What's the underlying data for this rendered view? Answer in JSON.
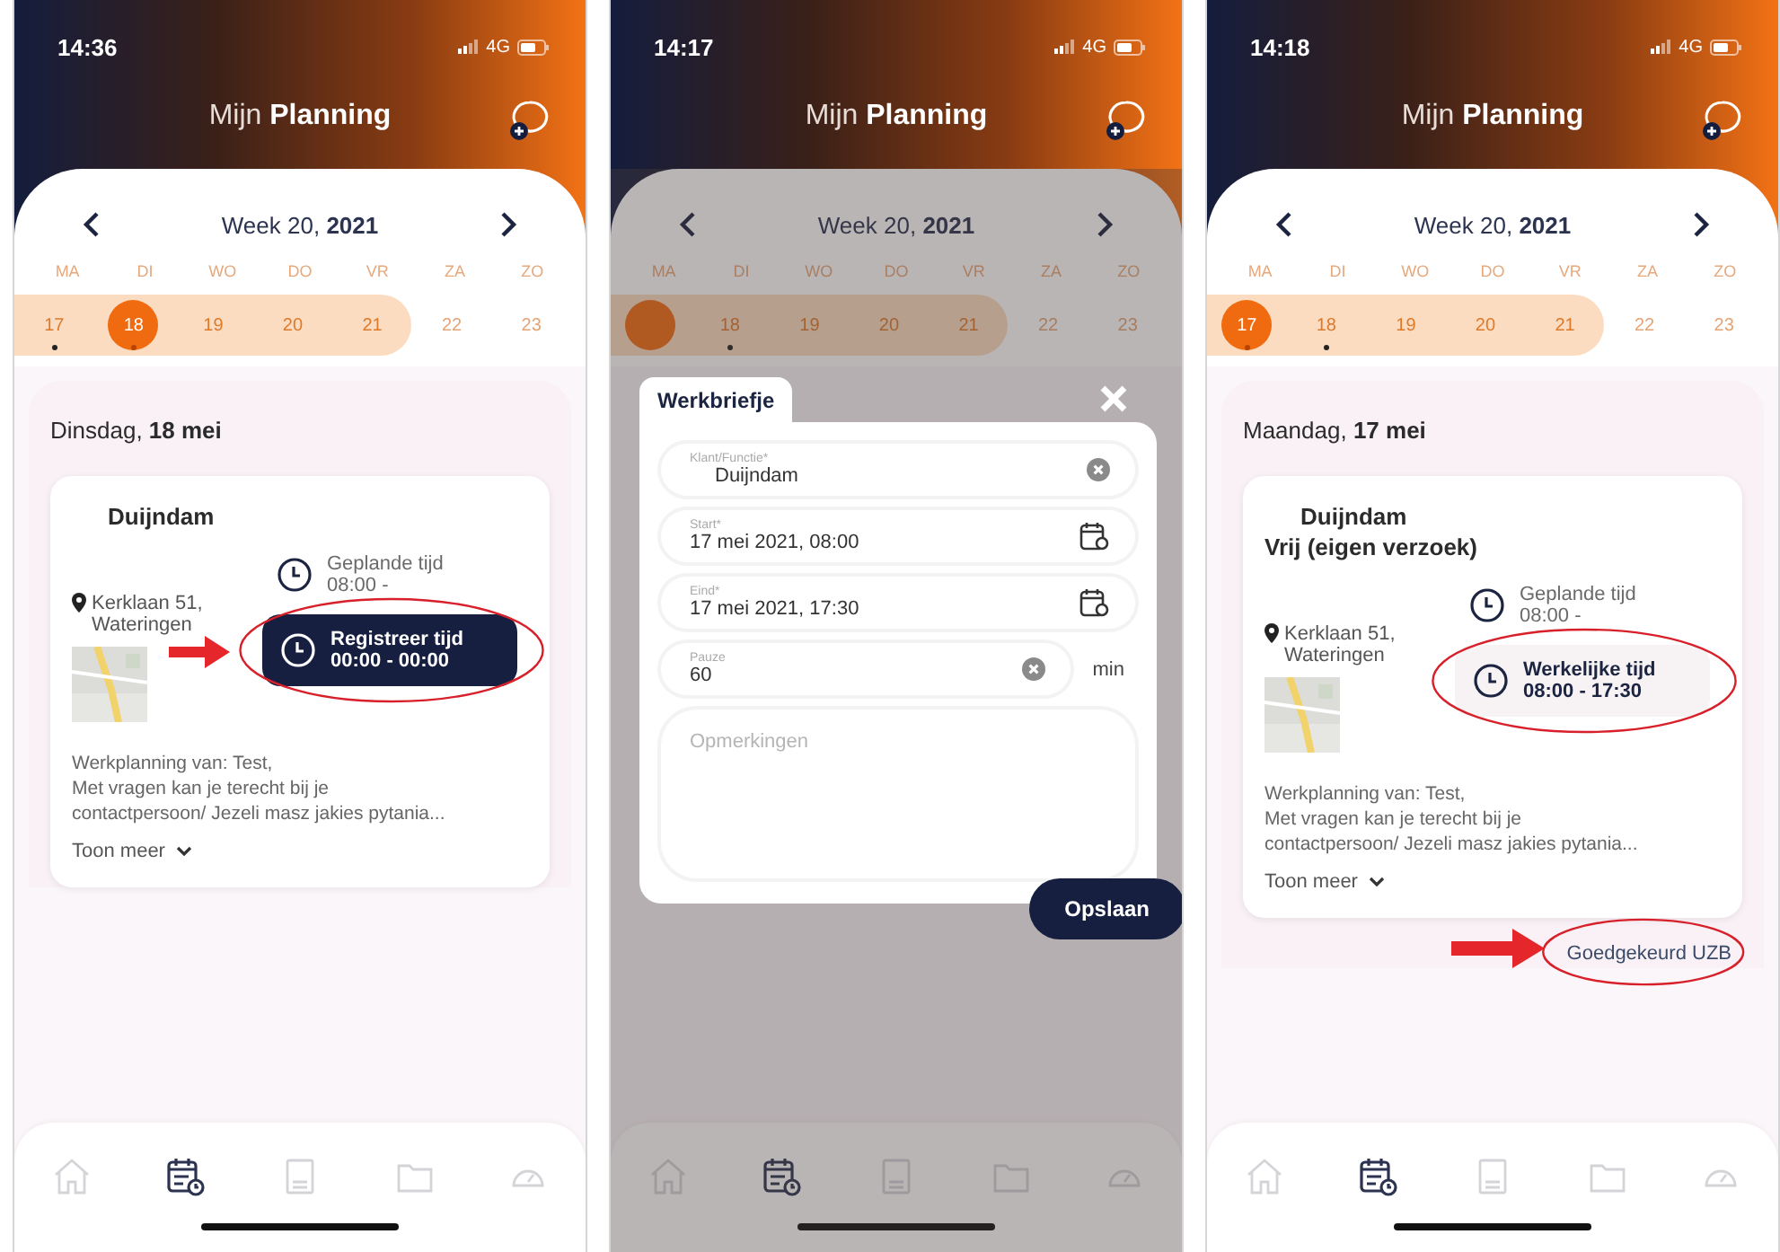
{
  "phones": [
    {
      "status": {
        "time": "14:36",
        "network": "4G"
      },
      "title": "Mijn **Planning**",
      "week": "Week 20, **2021**",
      "weekdays": [
        "MA",
        "DI",
        "WO",
        "DO",
        "VR",
        "ZA",
        "ZO"
      ],
      "days": [
        {
          "number": "17",
          "selected": false,
          "in_range": true,
          "has_event": true
        },
        {
          "number": "18",
          "selected": true,
          "in_range": true,
          "has_event": true
        },
        {
          "number": "19",
          "selected": false,
          "in_range": true,
          "has_event": false
        },
        {
          "number": "20",
          "selected": false,
          "in_range": true,
          "has_event": false
        },
        {
          "number": "21",
          "selected": false,
          "in_range": true,
          "has_event": false
        },
        {
          "number": "22",
          "selected": false,
          "in_range": false,
          "has_event": false
        },
        {
          "number": "23",
          "selected": false,
          "in_range": false,
          "has_event": false
        }
      ],
      "date": "Dinsdag, **18 mei**",
      "card": {
        "titles": [
          "Duijndam"
        ],
        "address": [
          "Kerklaan 51,",
          "Wateringen"
        ],
        "planned": {
          "label": "Geplande tijd",
          "time": "08:00 -"
        },
        "time_button": {
          "kind": "register",
          "label": "Registreer tijd",
          "time": "00:00 - 00:00",
          "arrow": true,
          "circled": true
        },
        "notes": [
          "Werkplanning van: Test,",
          "Met vragen kan je terecht bij je",
          "contactpersoon/ Jezeli masz jakies pytania..."
        ],
        "more": "Toon meer"
      },
      "nav": [
        {
          "kind": "home",
          "selected": false
        },
        {
          "kind": "calendar",
          "selected": true
        },
        {
          "kind": "document",
          "selected": false
        },
        {
          "kind": "folder",
          "selected": false
        },
        {
          "kind": "gauge",
          "selected": false
        }
      ]
    },
    {
      "status": {
        "time": "14:17",
        "network": "4G"
      },
      "title": "Mijn **Planning**",
      "week": "Week 20, **2021**",
      "weekdays": [
        "MA",
        "DI",
        "WO",
        "DO",
        "VR",
        "ZA",
        "ZO"
      ],
      "days": [
        {
          "selected": true,
          "in_range": true,
          "has_event": false
        },
        {
          "number": "18",
          "selected": false,
          "in_range": true,
          "has_event": true
        },
        {
          "number": "19",
          "selected": false,
          "in_range": true,
          "has_event": false
        },
        {
          "number": "20",
          "selected": false,
          "in_range": true,
          "has_event": false
        },
        {
          "number": "21",
          "selected": false,
          "in_range": true,
          "has_event": false
        },
        {
          "number": "22",
          "selected": false,
          "in_range": false,
          "has_event": false
        },
        {
          "number": "23",
          "selected": false,
          "in_range": false,
          "has_event": false
        }
      ],
      "dimmed": true,
      "modal": {
        "tag": "Werkbriefje",
        "fields": [
          {
            "kind": "select",
            "label": "Klant/Functie*",
            "value": "Duijndam"
          },
          {
            "kind": "date",
            "label": "Start*",
            "value": "17 mei 2021, 08:00"
          },
          {
            "kind": "date",
            "label": "Eind*",
            "value": "17 mei 2021, 17:30"
          },
          {
            "kind": "number",
            "label": "Pauze",
            "value": "60",
            "unit": "min"
          },
          {
            "kind": "textarea",
            "placeholder": "Opmerkingen"
          }
        ],
        "save": "Opslaan"
      },
      "nav": [
        {
          "kind": "home",
          "selected": false
        },
        {
          "kind": "calendar",
          "selected": true
        },
        {
          "kind": "document",
          "selected": false
        },
        {
          "kind": "folder",
          "selected": false
        },
        {
          "kind": "gauge",
          "selected": false
        }
      ]
    },
    {
      "status": {
        "time": "14:18",
        "network": "4G"
      },
      "title": "Mijn **Planning**",
      "week": "Week 20, **2021**",
      "weekdays": [
        "MA",
        "DI",
        "WO",
        "DO",
        "VR",
        "ZA",
        "ZO"
      ],
      "days": [
        {
          "number": "17",
          "selected": true,
          "in_range": true,
          "has_event": true
        },
        {
          "number": "18",
          "selected": false,
          "in_range": true,
          "has_event": true
        },
        {
          "number": "19",
          "selected": false,
          "in_range": true,
          "has_event": false
        },
        {
          "number": "20",
          "selected": false,
          "in_range": true,
          "has_event": false
        },
        {
          "number": "21",
          "selected": false,
          "in_range": true,
          "has_event": false
        },
        {
          "number": "22",
          "selected": false,
          "in_range": false,
          "has_event": false
        },
        {
          "number": "23",
          "selected": false,
          "in_range": false,
          "has_event": false
        }
      ],
      "date": "Maandag, **17 mei**",
      "card": {
        "titles": [
          "Duijndam",
          "Vrij (eigen verzoek)"
        ],
        "address": [
          "Kerklaan 51,",
          "Wateringen"
        ],
        "planned": {
          "label": "Geplande tijd",
          "time": "08:00 -"
        },
        "time_button": {
          "kind": "actual",
          "label": "Werkelijke tijd",
          "time": "08:00 - 17:30",
          "arrow": false,
          "circled": true
        },
        "notes": [
          "Werkplanning van: Test,",
          "Met vragen kan je terecht bij je",
          "contactpersoon/ Jezeli masz jakies pytania..."
        ],
        "more": "Toon meer",
        "status": {
          "text": "Goedgekeurd UZB",
          "arrow": true,
          "circled": true
        }
      },
      "nav": [
        {
          "kind": "home",
          "selected": false
        },
        {
          "kind": "calendar",
          "selected": true
        },
        {
          "kind": "document",
          "selected": false
        },
        {
          "kind": "folder",
          "selected": false
        },
        {
          "kind": "gauge",
          "selected": false
        }
      ]
    }
  ]
}
